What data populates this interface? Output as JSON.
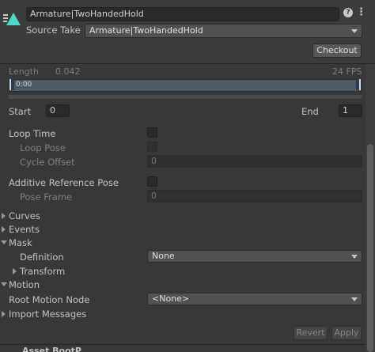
{
  "header": {
    "clip_name": "Armature|TwoHandedHold",
    "source_take_label": "Source Take",
    "source_take_value": "Armature|TwoHandedHold",
    "checkout_label": "Checkout"
  },
  "timeline": {
    "length_label": "Length",
    "length_value": "0.042",
    "fps_label": "24 FPS",
    "time_label": "0:00"
  },
  "range": {
    "start_label": "Start",
    "start_value": "0",
    "end_label": "End",
    "end_value": "1"
  },
  "loop": {
    "loop_time_label": "Loop Time",
    "loop_pose_label": "Loop Pose",
    "cycle_offset_label": "Cycle Offset",
    "cycle_offset_value": "0"
  },
  "additive": {
    "label": "Additive Reference Pose",
    "pose_frame_label": "Pose Frame",
    "pose_frame_value": "0"
  },
  "foldouts": {
    "curves": "Curves",
    "events": "Events",
    "mask": "Mask",
    "definition_label": "Definition",
    "definition_value": "None",
    "transform": "Transform",
    "motion": "Motion",
    "root_motion_label": "Root Motion Node",
    "root_motion_value": "<None>",
    "import_messages": "Import Messages"
  },
  "footer": {
    "revert_label": "Revert",
    "apply_label": "Apply",
    "next_section_label": "Asset BootP..."
  },
  "colors": {
    "background": "#383838",
    "field": "#2a2a2a",
    "accent_icon": "#4fd8c8"
  }
}
